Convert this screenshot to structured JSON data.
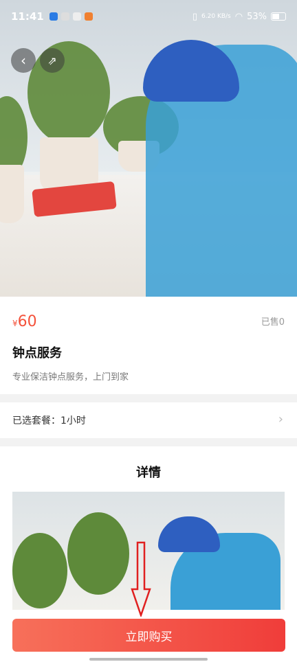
{
  "status_bar": {
    "time": "11:41",
    "net_speed": "6.20 KB/s",
    "battery": "53%"
  },
  "product": {
    "price_currency": "¥",
    "price": "60",
    "sold": "已售0",
    "title": "钟点服务",
    "description": "专业保洁钟点服务，上门到家"
  },
  "package": {
    "label": "已选套餐：1小时"
  },
  "detail": {
    "title": "详情"
  },
  "action": {
    "buy_label": "立即购买"
  },
  "colors": {
    "accent": "#f4523b",
    "buy_button_start": "#f7705a",
    "buy_button_end": "#f03d3a"
  }
}
